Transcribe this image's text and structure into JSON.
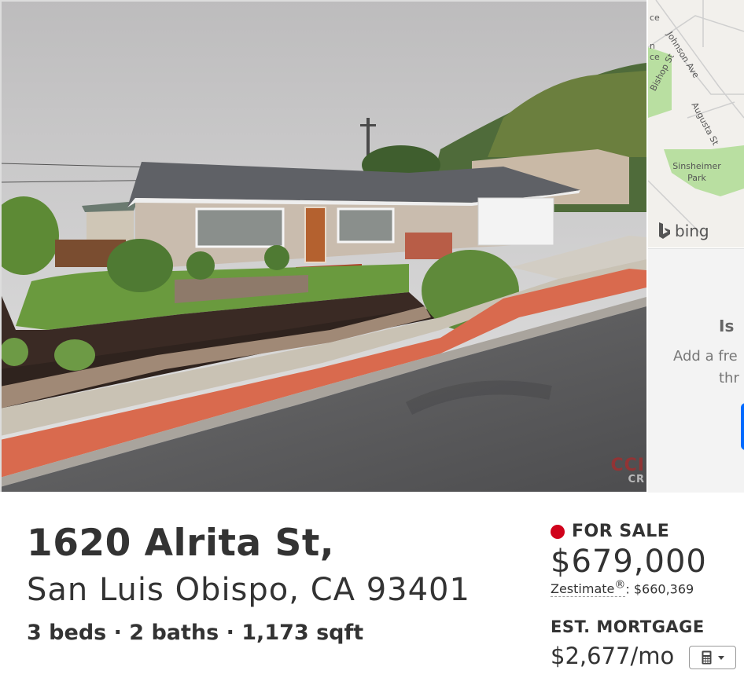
{
  "photo": {
    "watermark": "CCI",
    "watermark_sub": "CR"
  },
  "map": {
    "streets": [
      "Johnson Ave",
      "Bishop St",
      "Augusta St"
    ],
    "edge_fragments": [
      "ce",
      "n",
      "ce"
    ],
    "park": "Sinsheimer Park",
    "provider": "bing"
  },
  "panel": {
    "title": "Is",
    "text_line1": "Add a fre",
    "text_line2": "thr"
  },
  "listing": {
    "street": "1620 Alrita St,",
    "city_line": "San Luis Obispo, CA 93401",
    "facts": "3 beds · 2 baths · 1,173 sqft",
    "status": "FOR SALE",
    "status_color": "#d0021b",
    "price": "$679,000",
    "zestimate_label": "Zestimate",
    "zestimate_mark": "®",
    "zestimate_value": ": $660,369",
    "mortgage_label": "EST. MORTGAGE",
    "mortgage_value": "$2,677/mo",
    "calculator_icon": "calculator-icon"
  }
}
